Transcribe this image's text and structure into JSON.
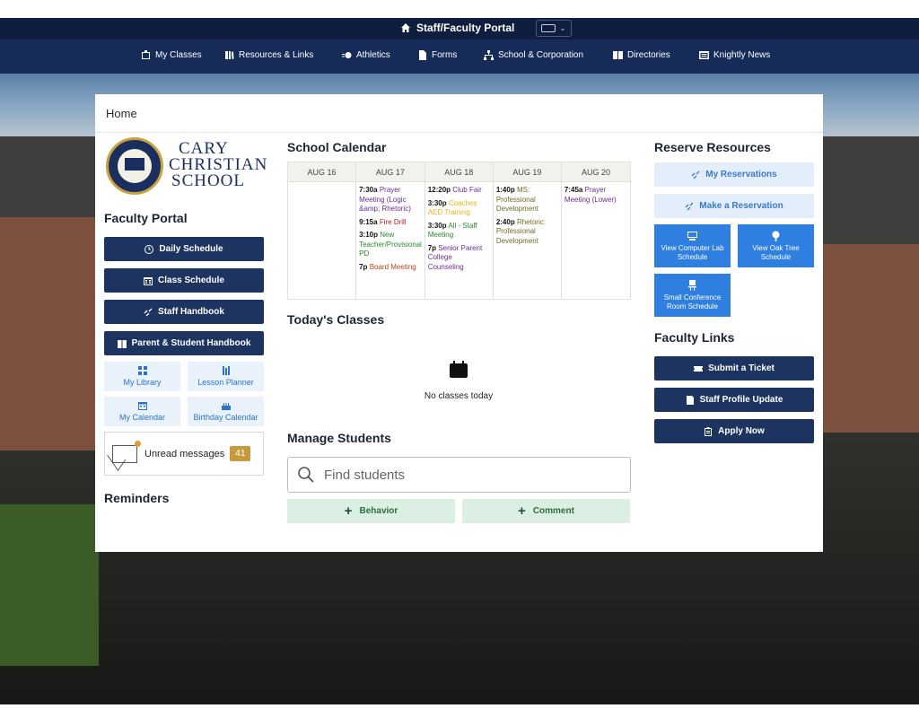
{
  "header": {
    "portal_title": "Staff/Faculty Portal",
    "switcher_caret": "⌄"
  },
  "nav": {
    "items": [
      {
        "label": "My Classes",
        "icon": "classroom-icon"
      },
      {
        "label": "Resources & Links",
        "icon": "books-icon"
      },
      {
        "label": "Athletics",
        "icon": "athletics-icon"
      },
      {
        "label": "Forms",
        "icon": "document-icon"
      },
      {
        "label": "School & Corporation",
        "icon": "org-chart-icon"
      },
      {
        "label": "Directories",
        "icon": "directory-icon"
      },
      {
        "label": "Knightly News",
        "icon": "news-icon"
      }
    ]
  },
  "breadcrumb": "Home",
  "logo": {
    "line1": "CARY",
    "line2": "CHRISTIAN",
    "line3": "SCHOOL"
  },
  "left": {
    "portal_heading": "Faculty Portal",
    "buttons": [
      {
        "label": "Daily Schedule",
        "icon": "clock-icon"
      },
      {
        "label": "Class Schedule",
        "icon": "calendar-grid-icon"
      },
      {
        "label": "Staff Handbook",
        "icon": "link-icon"
      },
      {
        "label": "Parent & Student Handbook",
        "icon": "book-icon"
      }
    ],
    "tiles": [
      {
        "label": "My Library",
        "icon": "grid-icon"
      },
      {
        "label": "Lesson Planner",
        "icon": "planner-icon"
      },
      {
        "label": "My Calendar",
        "icon": "calendar-icon"
      },
      {
        "label": "Birthday Calendar",
        "icon": "cake-icon"
      }
    ],
    "messages_label": "Unread messages",
    "messages_count": "41",
    "reminders_heading": "Reminders"
  },
  "calendar": {
    "heading": "School Calendar",
    "days": [
      {
        "label": "AUG 16",
        "events": []
      },
      {
        "label": "AUG 17",
        "events": [
          {
            "time": "7:30a",
            "title": "Prayer Meeting (Logic &amp; Rhetoric)",
            "color": "purple"
          },
          {
            "time": "9:15a",
            "title": "Fire Drill",
            "color": "red"
          },
          {
            "time": "3:10p",
            "title": "New Teacher/Provisional PD",
            "color": "green"
          },
          {
            "time": "7p",
            "title": "Board Meeting",
            "color": "brown"
          }
        ]
      },
      {
        "label": "AUG 18",
        "events": [
          {
            "time": "12:20p",
            "title": "Club Fair",
            "color": "purple"
          },
          {
            "time": "3:30p",
            "title": "Coaches AED Training",
            "color": "yellow"
          },
          {
            "time": "3:30p",
            "title": "All - Staff Meeting",
            "color": "green"
          },
          {
            "time": "7p",
            "title": "Senior Parent College Counseling",
            "color": "purple"
          }
        ]
      },
      {
        "label": "AUG 19",
        "events": [
          {
            "time": "1:40p",
            "title": "MS: Professional Development",
            "color": "olive"
          },
          {
            "time": "2:40p",
            "title": "Rhetoric: Professional Development",
            "color": "olive"
          }
        ]
      },
      {
        "label": "AUG 20",
        "events": [
          {
            "time": "7:45a",
            "title": "Prayer Meeting (Lower)",
            "color": "purple"
          }
        ]
      }
    ]
  },
  "classes": {
    "heading": "Today's Classes",
    "empty_text": "No classes today"
  },
  "students": {
    "heading": "Manage Students",
    "search_placeholder": "Find students",
    "behavior_label": "Behavior",
    "comment_label": "Comment"
  },
  "reserve": {
    "heading": "Reserve Resources",
    "my_reservations": "My Reservations",
    "make_reservation": "Make a Reservation",
    "lab_line1": "View Computer Lab",
    "lab_line2": "Schedule",
    "oak_line1": "View Oak Tree",
    "oak_line2": "Schedule",
    "conf_line1": "Small Conference",
    "conf_line2": "Room Schedule"
  },
  "faculty_links": {
    "heading": "Faculty Links",
    "items": [
      {
        "label": "Submit a Ticket",
        "icon": "ticket-icon"
      },
      {
        "label": "Staff Profile Update",
        "icon": "profile-form-icon"
      },
      {
        "label": "Apply Now",
        "icon": "clipboard-icon"
      }
    ]
  }
}
